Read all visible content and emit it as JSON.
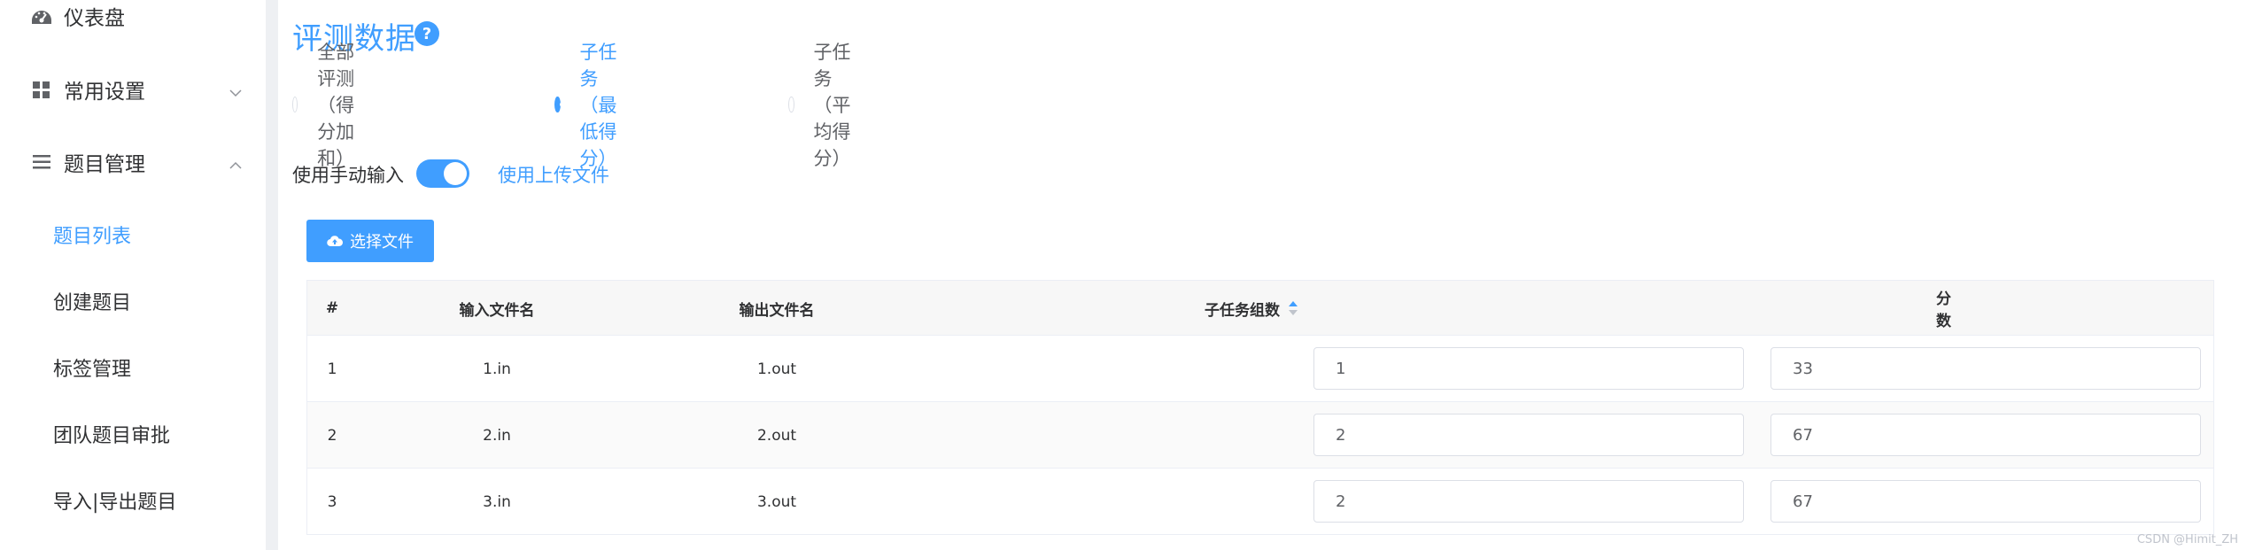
{
  "sidebar": {
    "items": [
      {
        "label": "仪表盘",
        "icon": "dashboard-icon"
      },
      {
        "label": "常用设置",
        "icon": "grid-icon",
        "chevron": "chevron-down-icon"
      },
      {
        "label": "题目管理",
        "icon": "menu-icon",
        "chevron": "chevron-up-icon"
      }
    ],
    "subitems": [
      {
        "label": "题目列表",
        "active": true
      },
      {
        "label": "创建题目"
      },
      {
        "label": "标签管理"
      },
      {
        "label": "团队题目审批"
      },
      {
        "label": "导入|导出题目"
      }
    ]
  },
  "main": {
    "title": "评测数据",
    "help_icon": "question-circle-icon",
    "judge_modes": [
      {
        "label": "全部评测（得分加和）",
        "checked": false
      },
      {
        "label": "子任务（最低得分）",
        "checked": true
      },
      {
        "label": "子任务（平均得分）",
        "checked": false
      }
    ],
    "switch": {
      "left_label": "使用手动输入",
      "right_label": "使用上传文件",
      "on": true
    },
    "upload_button": "选择文件",
    "table": {
      "headers": [
        "#",
        "输入文件名",
        "输出文件名",
        "子任务组数",
        "分数"
      ],
      "rows": [
        {
          "index": "1",
          "input": "1.in",
          "output": "1.out",
          "group": "1",
          "score": "33"
        },
        {
          "index": "2",
          "input": "2.in",
          "output": "2.out",
          "group": "2",
          "score": "67"
        },
        {
          "index": "3",
          "input": "3.in",
          "output": "3.out",
          "group": "2",
          "score": "67"
        }
      ]
    }
  },
  "watermark": "CSDN @Himit_ZH",
  "colors": {
    "accent": "#409eff",
    "text": "#303133",
    "muted": "#606266",
    "border": "#dcdfe6"
  }
}
